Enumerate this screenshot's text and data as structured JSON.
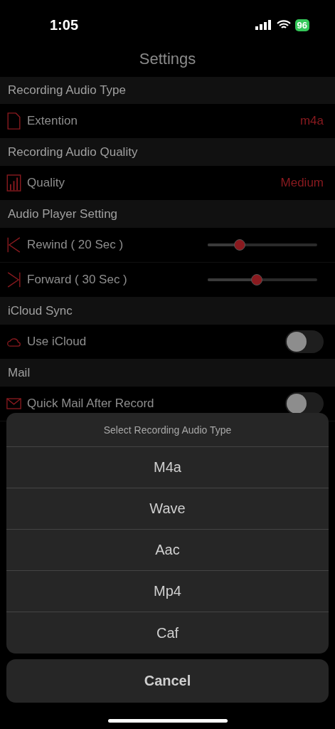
{
  "status_bar": {
    "time": "1:05",
    "battery": "96"
  },
  "title": "Settings",
  "sections": [
    {
      "header": "Recording Audio Type",
      "rows": [
        {
          "kind": "value",
          "label": "Extention",
          "value": "m4a"
        }
      ]
    },
    {
      "header": "Recording Audio Quality",
      "rows": [
        {
          "kind": "value",
          "label": "Quality",
          "value": "Medium"
        }
      ]
    },
    {
      "header": "Audio Player Setting",
      "rows": [
        {
          "kind": "slider",
          "label": "Rewind ( 20 Sec )",
          "level": 0.29
        },
        {
          "kind": "slider",
          "label": "Forward ( 30 Sec )",
          "level": 0.45
        }
      ]
    },
    {
      "header": "iCloud Sync",
      "rows": [
        {
          "kind": "toggle",
          "label": "Use  iCloud",
          "on": false
        }
      ]
    },
    {
      "header": "Mail",
      "rows": [
        {
          "kind": "toggle",
          "label": "Quick Mail After Record",
          "on": false
        }
      ]
    }
  ],
  "action_sheet": {
    "title": "Select Recording Audio Type",
    "options": [
      "M4a",
      "Wave",
      "Aac",
      "Mp4",
      "Caf"
    ],
    "cancel": "Cancel"
  }
}
